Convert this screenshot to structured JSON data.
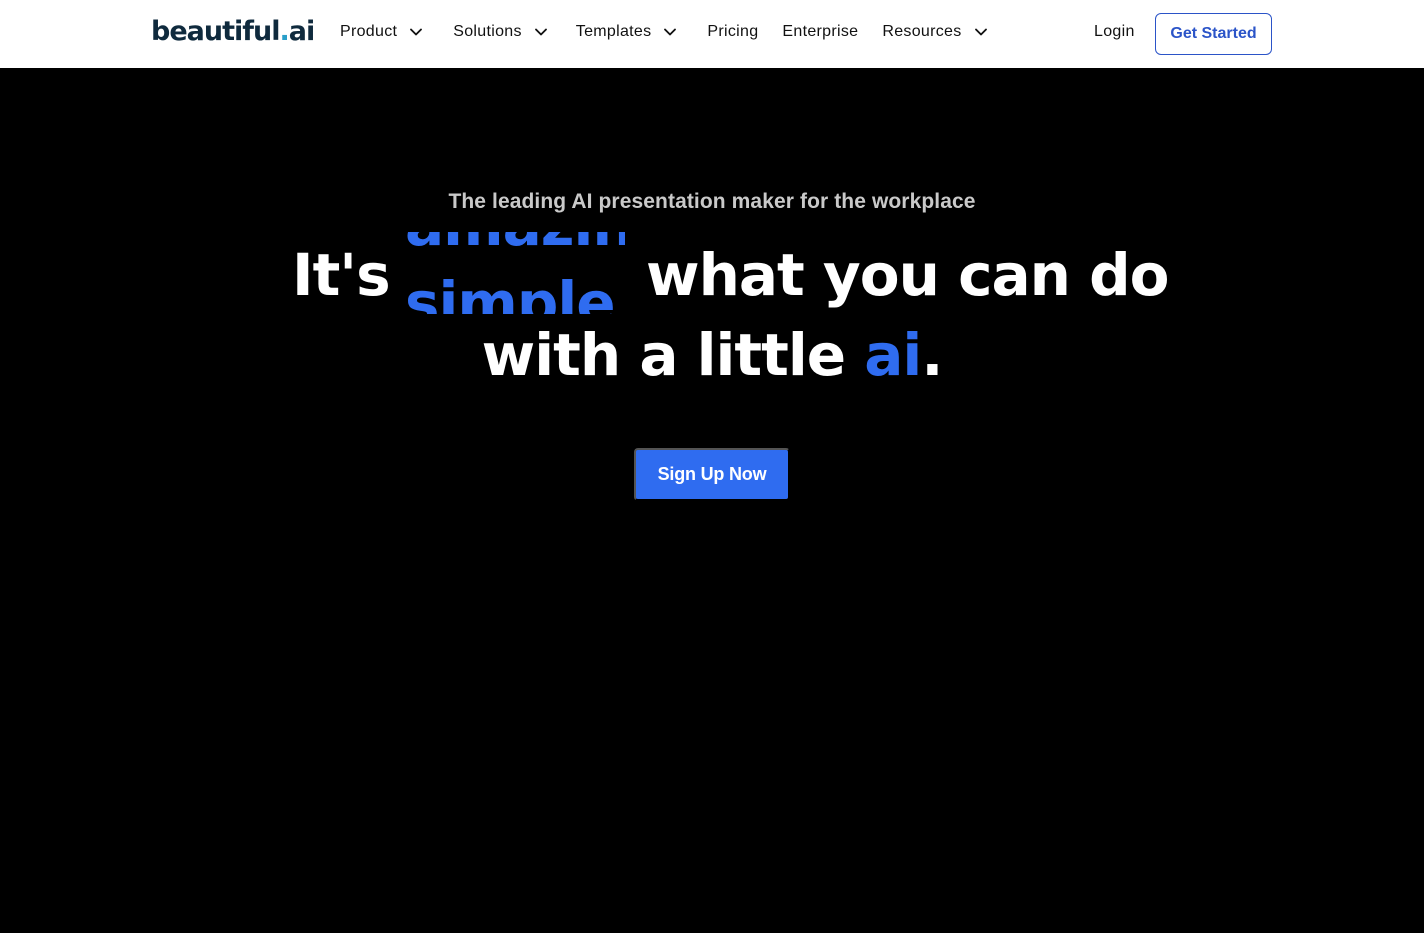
{
  "header": {
    "logo": {
      "main": "beautiful",
      "dot": ".",
      "suffix": "ai"
    },
    "nav": [
      {
        "label": "Product",
        "has_dropdown": true
      },
      {
        "label": "Solutions",
        "has_dropdown": true
      },
      {
        "label": "Templates",
        "has_dropdown": true
      },
      {
        "label": "Pricing",
        "has_dropdown": false
      },
      {
        "label": "Enterprise",
        "has_dropdown": false
      },
      {
        "label": "Resources",
        "has_dropdown": true
      }
    ],
    "login_label": "Login",
    "get_started_label": "Get Started"
  },
  "hero": {
    "tagline": "The leading AI presentation maker for the workplace",
    "headline_prefix": "It's",
    "rotating_word_prev": "amazin",
    "rotating_word": "simple",
    "headline_suffix": "what you can do",
    "line2_text": "with a little",
    "line2_highlight": "ai",
    "line2_end": ".",
    "cta_label": "Sign Up Now"
  },
  "colors": {
    "accent_blue": "#2f6cf0",
    "outline_button": "#2b54c8",
    "logo_dark": "#0f2a3d",
    "logo_dot": "#2a9fc9",
    "hero_background": "#000000",
    "tagline_gray": "#c9c9c9"
  },
  "icons": {
    "dropdown": "chevron-down-icon"
  }
}
